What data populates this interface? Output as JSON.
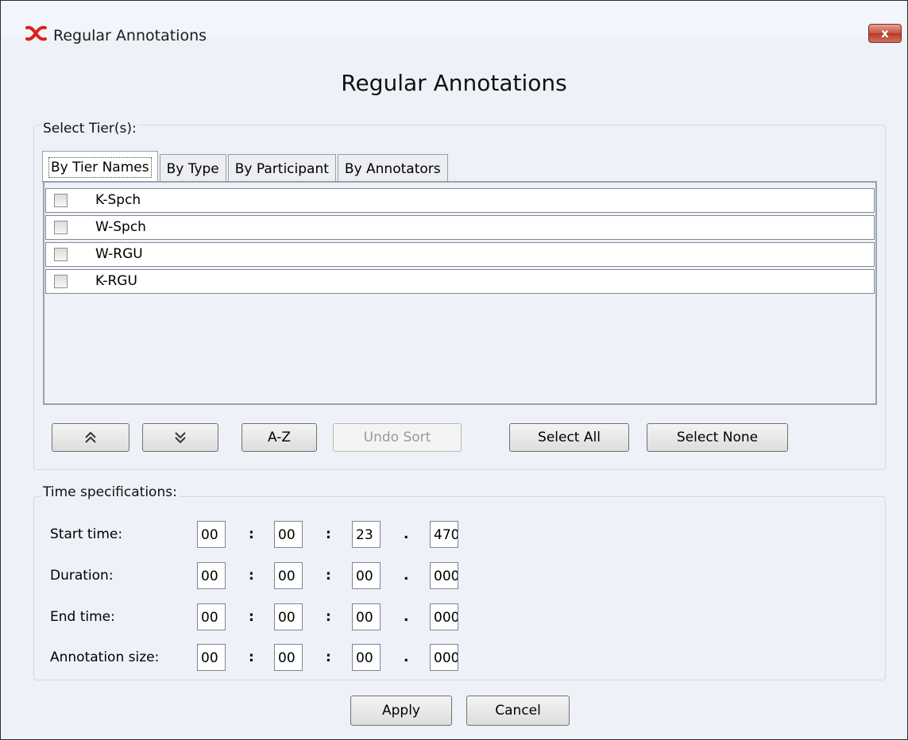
{
  "window": {
    "title": "Regular Annotations",
    "close_label": "x"
  },
  "heading": "Regular Annotations",
  "tier_group": {
    "label": "Select Tier(s):",
    "tabs": [
      "By Tier Names",
      "By Type",
      "By Participant",
      "By Annotators"
    ],
    "active_tab": 0,
    "tiers": [
      {
        "name": "K-Spch",
        "checked": false
      },
      {
        "name": "W-Spch",
        "checked": false
      },
      {
        "name": "W-RGU",
        "checked": false
      },
      {
        "name": "K-RGU",
        "checked": false
      }
    ],
    "buttons": {
      "move_up_icon": "double-chevron-up-icon",
      "move_down_icon": "double-chevron-down-icon",
      "sort_az": "A-Z",
      "undo_sort": "Undo Sort",
      "select_all": "Select All",
      "select_none": "Select None"
    }
  },
  "time_group": {
    "label": "Time specifications:",
    "colon": ":",
    "dot": ".",
    "rows": [
      {
        "label": "Start time:",
        "h": "00",
        "m": "00",
        "s": "23",
        "ms": "470"
      },
      {
        "label": "Duration:",
        "h": "00",
        "m": "00",
        "s": "00",
        "ms": "000"
      },
      {
        "label": "End time:",
        "h": "00",
        "m": "00",
        "s": "00",
        "ms": "000"
      },
      {
        "label": "Annotation size:",
        "h": "00",
        "m": "00",
        "s": "00",
        "ms": "000"
      }
    ]
  },
  "footer": {
    "apply": "Apply",
    "cancel": "Cancel"
  }
}
